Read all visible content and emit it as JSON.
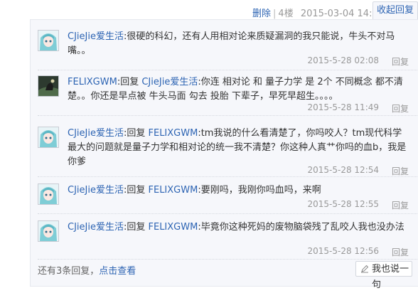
{
  "header": {
    "delete_label": "删除",
    "separator": "|",
    "floor": "4楼",
    "datetime": "2015-03-04 14:48",
    "fold_reply_label": "收起回复"
  },
  "replies": [
    {
      "user": "CJieJie爱生活",
      "colon": ":",
      "reply_prefix": "",
      "target": "",
      "text": "很硬的科幻，还有人用相对论来质疑漏洞的我只能说，牛头不对马嘴。。",
      "time": "2015-5-28 02:08",
      "reply_label": "回复",
      "avatar_icon": "anime-girl-avatar-icon"
    },
    {
      "user": "FELIXGWM",
      "colon": ":",
      "reply_prefix": "回复 ",
      "target": "CJieJie爱生活",
      "text": ":你连 相对论 和 量子力学 是 2个 不同概念 都不清楚。。你还是早点被 牛头马面 勾去 投胎 下辈子，早死早超生。。。。",
      "time": "2015-5-28 11:49",
      "reply_label": "回复",
      "avatar_icon": "dark-scene-avatar-icon"
    },
    {
      "user": "CJieJie爱生活",
      "colon": ":",
      "reply_prefix": "回复 ",
      "target": "FELIXGWM",
      "text": ":tm我说的什么看清楚了，你吗咬人？tm现代科学最大的问题就是量子力学和相对论的统一我不清楚？你这种人真艹你吗的血b，我是你爹",
      "time": "2015-5-28 12:54",
      "reply_label": "回复",
      "avatar_icon": "anime-girl-avatar-icon"
    },
    {
      "user": "CJieJie爱生活",
      "colon": ":",
      "reply_prefix": "回复 ",
      "target": "FELIXGWM",
      "text": ":要刚吗，我刚你吗血吗，来啊",
      "time": "2015-5-28 12:55",
      "reply_label": "回复",
      "avatar_icon": "anime-girl-avatar-icon"
    },
    {
      "user": "CJieJie爱生活",
      "colon": ":",
      "reply_prefix": "回复 ",
      "target": "FELIXGWM",
      "text": ":毕竟你这种死妈的废物脑袋残了乱咬人我也没办法",
      "time": "2015-5-28 12:56",
      "reply_label": "回复",
      "avatar_icon": "anime-girl-avatar-icon"
    }
  ],
  "footer": {
    "more_text": "还有3条回复，",
    "more_link": "点击查看",
    "say_button": "我也说一句",
    "say_icon": "pen-icon"
  }
}
